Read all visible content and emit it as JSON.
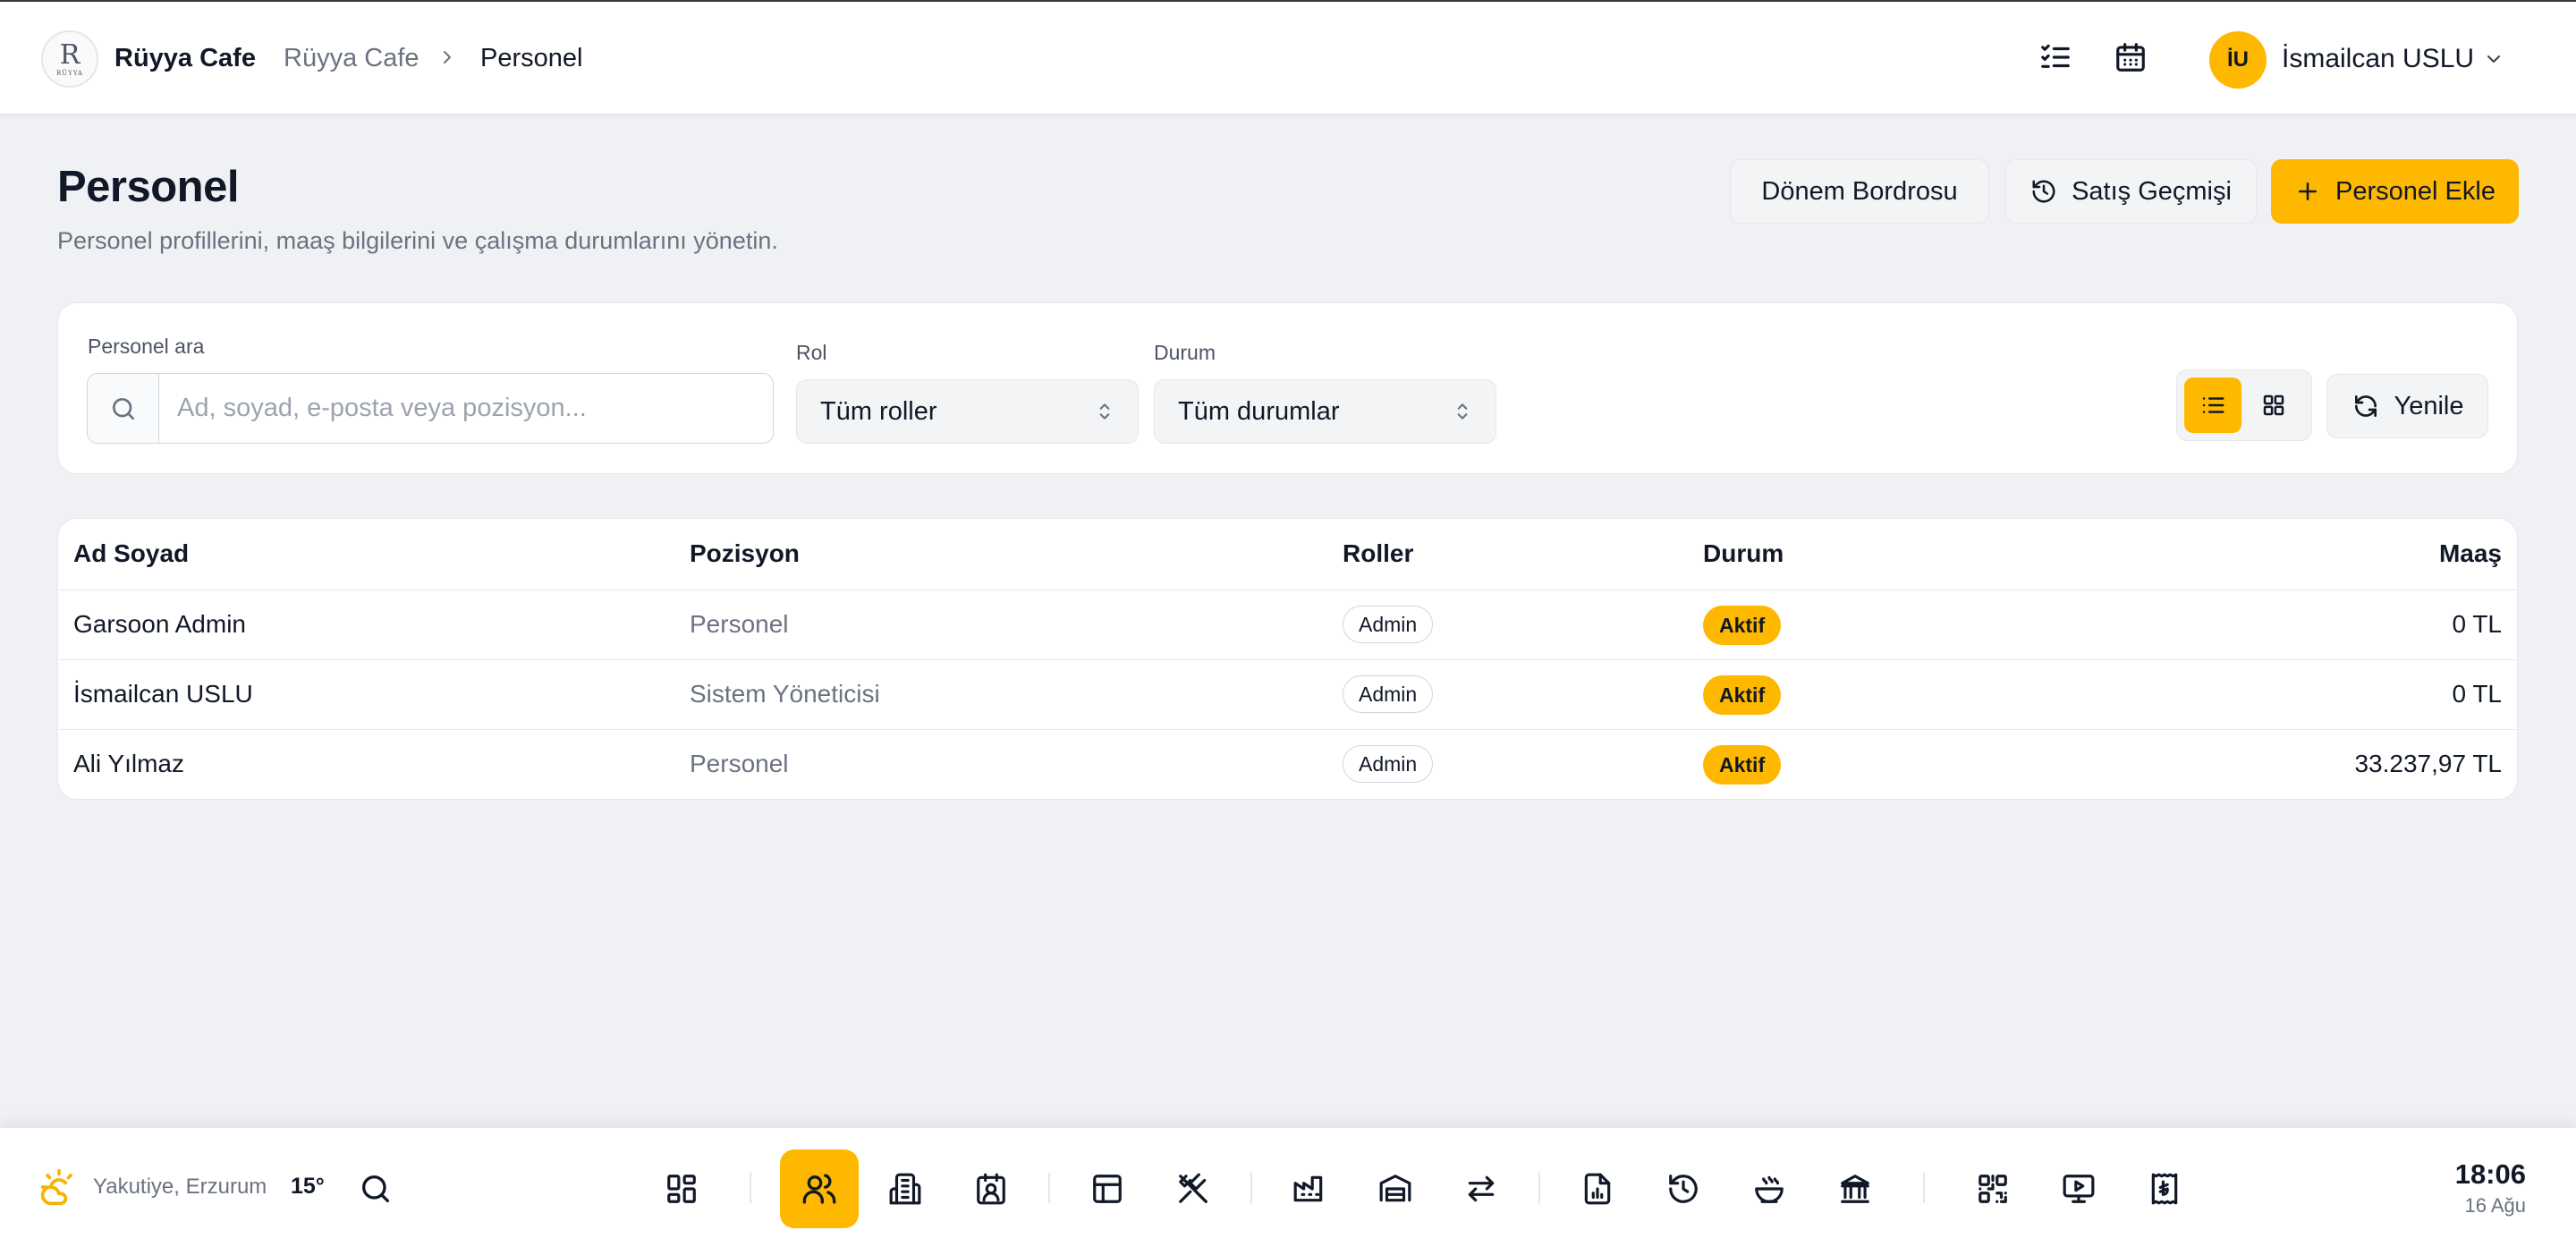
{
  "app": {
    "brand": "Rüyya Cafe",
    "logo_monogram": "R",
    "logo_text": "RÜYYA"
  },
  "breadcrumb": {
    "root": "Rüyya Cafe",
    "current": "Personel"
  },
  "user": {
    "initials": "İU",
    "name": "İsmailcan USLU"
  },
  "header": {
    "title": "Personel",
    "subtitle": "Personel profillerini, maaş bilgilerini ve çalışma durumlarını yönetin.",
    "buttons": {
      "payroll": "Dönem Bordrosu",
      "sales_history": "Satış Geçmişi",
      "add_staff": "Personel Ekle"
    }
  },
  "filters": {
    "search_label": "Personel ara",
    "search_placeholder": "Ad, soyad, e-posta veya pozisyon...",
    "role_label": "Rol",
    "role_value": "Tüm roller",
    "status_label": "Durum",
    "status_value": "Tüm durumlar",
    "refresh": "Yenile",
    "view_mode": "list"
  },
  "table": {
    "columns": {
      "name": "Ad Soyad",
      "position": "Pozisyon",
      "roles": "Roller",
      "status": "Durum",
      "salary": "Maaş"
    },
    "rows": [
      {
        "name": "Garsoon Admin",
        "position": "Personel",
        "role": "Admin",
        "status": "Aktif",
        "salary": "0 TL"
      },
      {
        "name": "İsmailcan USLU",
        "position": "Sistem Yöneticisi",
        "role": "Admin",
        "status": "Aktif",
        "salary": "0 TL"
      },
      {
        "name": "Ali Yılmaz",
        "position": "Personel",
        "role": "Admin",
        "status": "Aktif",
        "salary": "33.237,97 TL"
      }
    ]
  },
  "dock": {
    "weather": {
      "location": "Yakutiye, Erzurum",
      "temp": "15°",
      "icon": "partly-sunny-icon"
    },
    "active_item": "staff",
    "items": [
      "dashboard-icon",
      "staff-icon",
      "building-icon",
      "id-card-icon",
      "table-layout-icon",
      "utensils-off-icon",
      "factory-icon",
      "warehouse-icon",
      "transfer-icon",
      "report-icon",
      "history-icon",
      "bowl-icon",
      "bank-icon",
      "qr-code-icon",
      "presentation-icon",
      "receipt-lira-icon"
    ],
    "clock": {
      "time": "18:06",
      "date": "16 Ağu"
    }
  },
  "colors": {
    "accent": "#ffb800",
    "background": "#eff1f5",
    "text": "#111827",
    "muted": "#6b7280"
  }
}
